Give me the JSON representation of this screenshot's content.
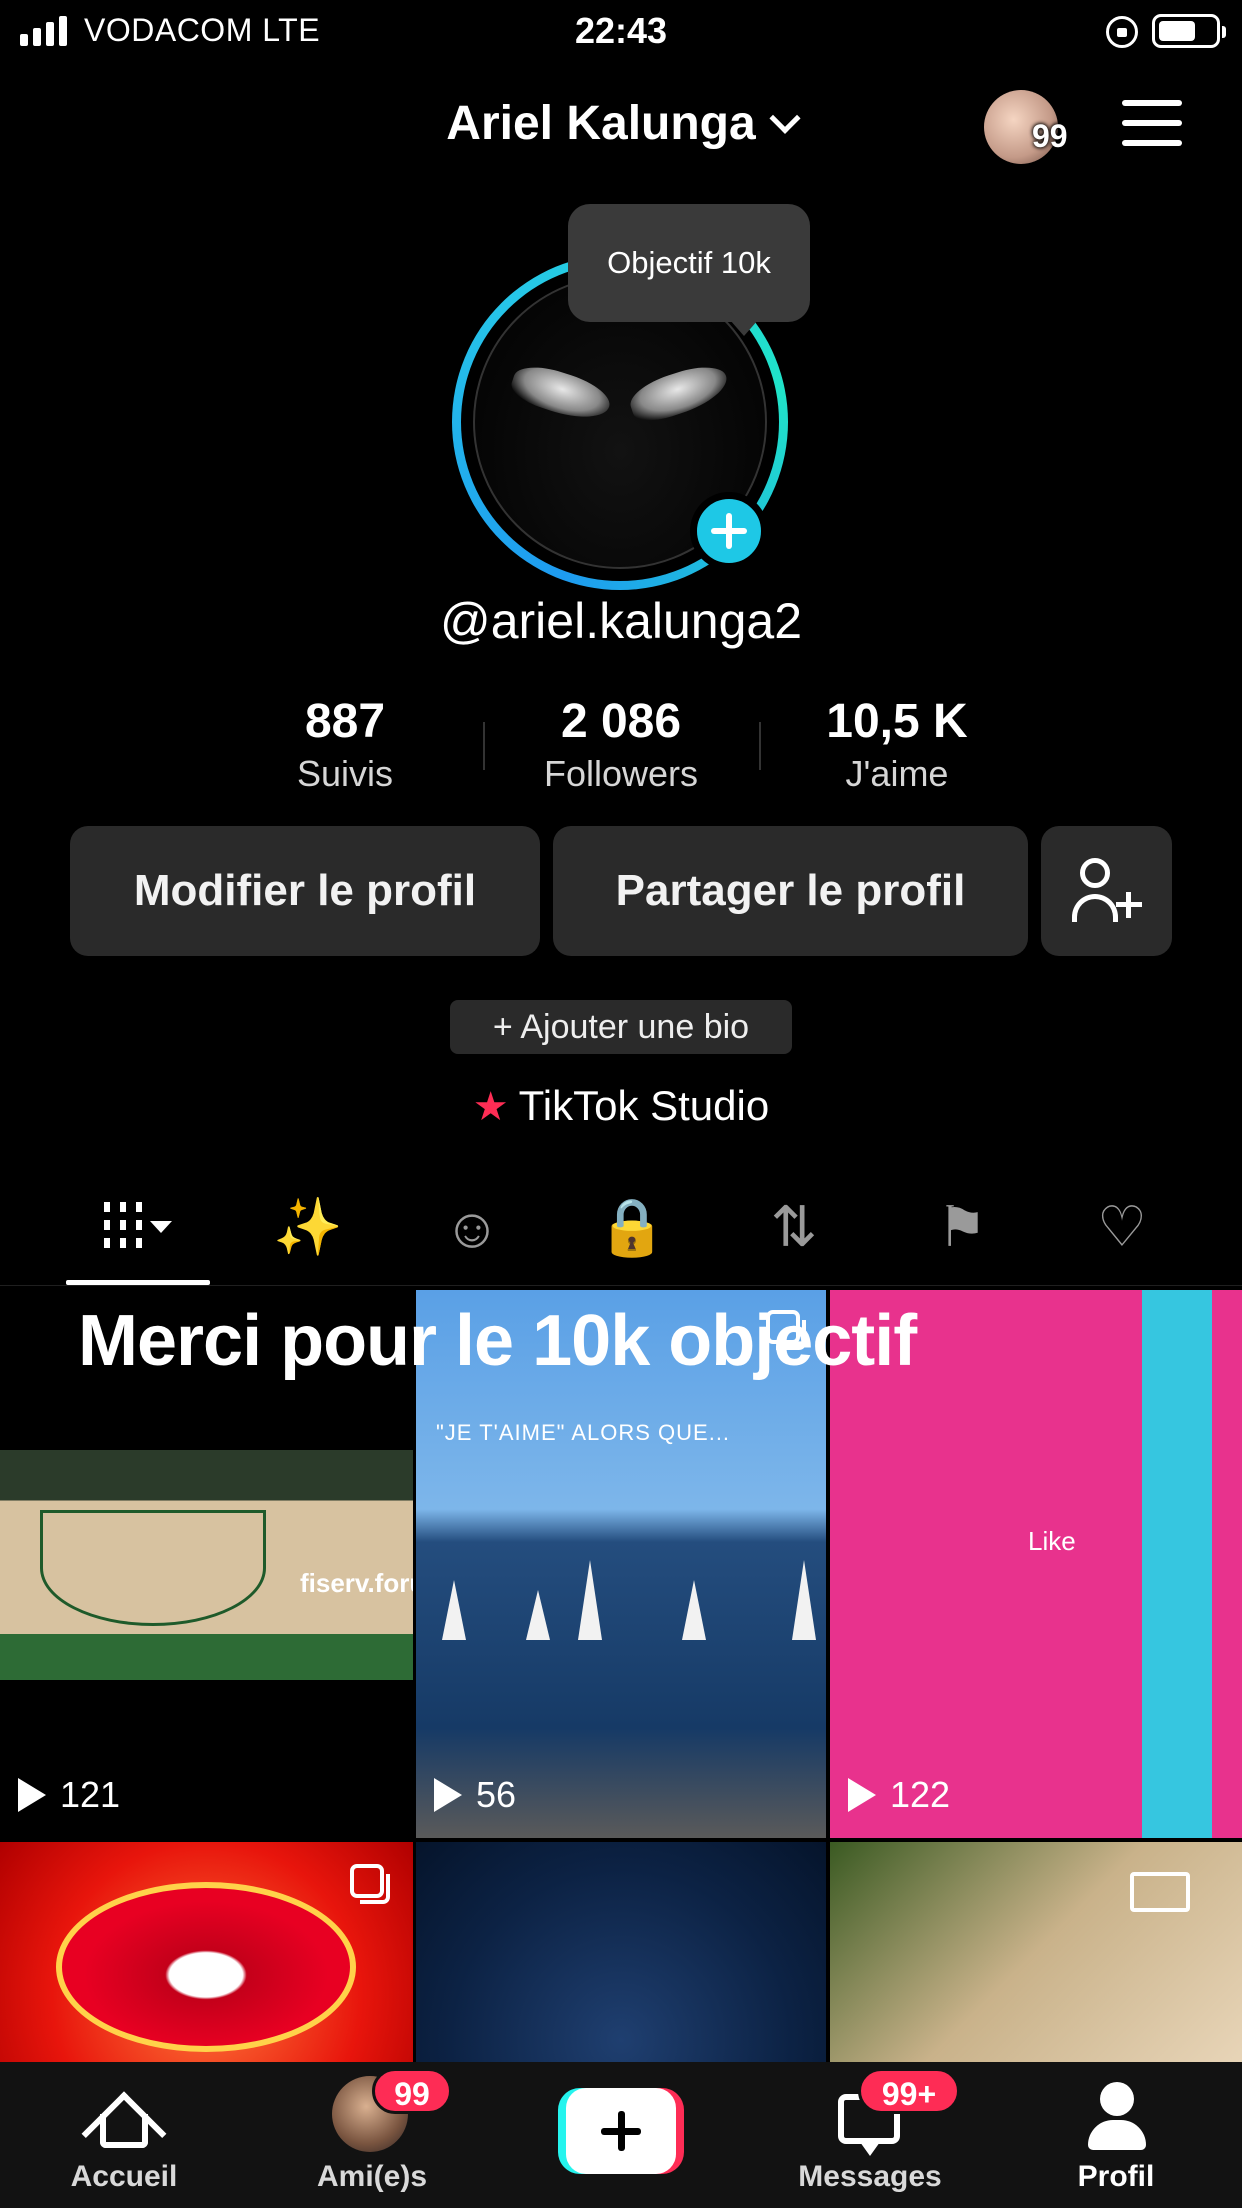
{
  "status_bar": {
    "carrier": "VODACOM  LTE",
    "time": "22:43"
  },
  "header": {
    "display_name": "Ariel Kalunga",
    "avatar_badge": "99"
  },
  "profile": {
    "tooltip": "Objectif 10k",
    "username": "@ariel.kalunga2",
    "stats": [
      {
        "value": "887",
        "label": "Suivis"
      },
      {
        "value": "2 086",
        "label": "Followers"
      },
      {
        "value": "10,5 K",
        "label": "J'aime"
      }
    ],
    "edit_button": "Modifier le profil",
    "share_button": "Partager le profil",
    "bio_button": "+ Ajouter une bio",
    "studio_link": "TikTok Studio"
  },
  "tabs": [
    {
      "icon": "grid-icon",
      "active": true
    },
    {
      "icon": "sparkle-icon"
    },
    {
      "icon": "sticker-icon"
    },
    {
      "icon": "lock-icon"
    },
    {
      "icon": "repost-icon"
    },
    {
      "icon": "bookmark-hidden-icon"
    },
    {
      "icon": "heart-hidden-icon"
    }
  ],
  "videos": {
    "overlay_title": "Merci pour le 10k objectif",
    "items": [
      {
        "views": "121"
      },
      {
        "views": "56",
        "caption": "\"JE T'AIME\" ALORS QUE..."
      },
      {
        "views": "122",
        "caption": "Like"
      }
    ],
    "court_brand": "fiserv.forum"
  },
  "bottom_nav": {
    "home": "Accueil",
    "friends": "Ami(e)s",
    "friends_badge": "99",
    "messages": "Messages",
    "messages_badge": "99+",
    "profile": "Profil"
  },
  "colors": {
    "accent": "#fe2c55",
    "cyan": "#25f4ee",
    "ring_start": "#1e9bf0",
    "ring_end": "#20e3c8"
  }
}
